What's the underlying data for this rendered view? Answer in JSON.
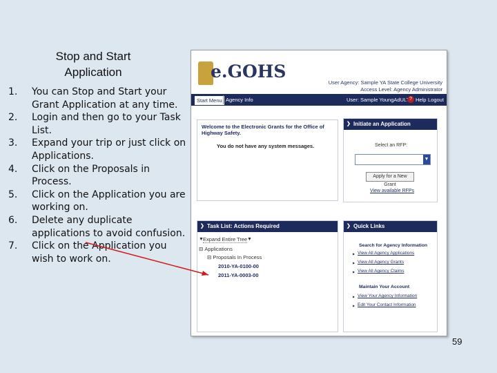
{
  "slide": {
    "title_line1": "Stop and Start",
    "title_line2": "Application",
    "page_number": "59",
    "steps": [
      {
        "num": "1.",
        "text": "You can Stop and Start your Grant Application at any time."
      },
      {
        "num": "2.",
        "text": "Login and then go to your Task List."
      },
      {
        "num": "3.",
        "text": "Expand your trip or just click on Applications."
      },
      {
        "num": "4.",
        "text": "Click on the Proposals in Process."
      },
      {
        "num": "5.",
        "text": "Click on the Application you are working on."
      },
      {
        "num": "6.",
        "text": "Delete any duplicate applications to avoid confusion."
      },
      {
        "num": "7.",
        "text": "Click on the Application you wish to work on."
      }
    ],
    "arrow_color": "#d11a1a"
  },
  "app": {
    "logo_text": "e.GOHS",
    "user_agency": "User Agency: Sample YA State College University",
    "access_level": "Access Level: Agency Administrator",
    "nav": {
      "tab_start": "Start Menu",
      "tab_agency": "Agency Info",
      "user": "User: Sample YoungAdULT",
      "help": "Help",
      "logout": "Logout"
    },
    "welcome_title": "Welcome to the Electronic Grants for the Office of Highway Safety.",
    "no_messages": "You do not have any system messages.",
    "initiate": {
      "title": "Initiate an Application",
      "select_label": "Select an RFP:",
      "button": "Apply for a New Grant",
      "link": "View available RFPs"
    },
    "task_list": {
      "title": "Task List: Actions Required",
      "expand": "Expand Entire Tree",
      "applications": "Applications",
      "proposals": "Proposals In Process",
      "app1": "2010-YA-0100-00",
      "app2": "2011-YA-0003-00"
    },
    "quick_links": {
      "title": "Quick Links",
      "search_heading": "Search for Agency Information",
      "link1": "View All Agency Applications",
      "link2": "View All Agency Grants",
      "link3": "View All Agency Claims",
      "maintain_heading": "Maintain Your Account",
      "link4": "View Your Agency Information",
      "link5": "Edit Your Contact Information"
    },
    "brand_navy": "#1d2a5c"
  }
}
